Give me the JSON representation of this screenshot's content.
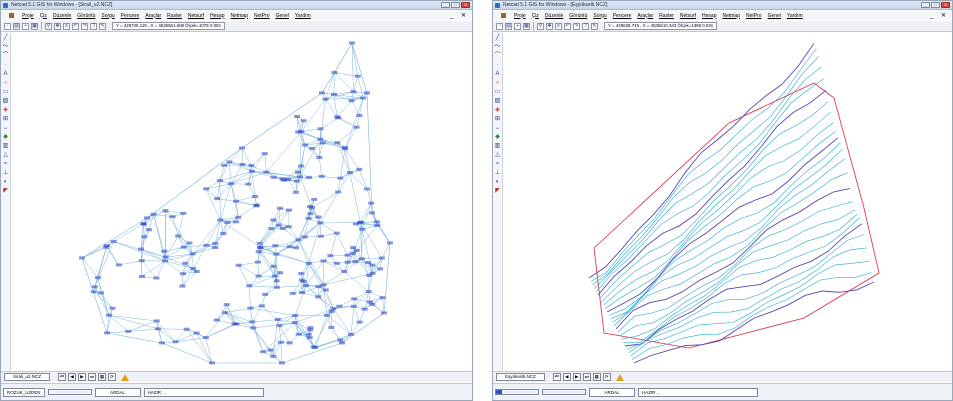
{
  "colors": {
    "tin_line": "#7fb7d9",
    "tin_label": "#2640c8",
    "contour_cyan": "#29a9cf",
    "contour_purple": "#5b43b6",
    "boundary_red": "#e0283a"
  },
  "menu": [
    "Proje",
    "Çiz",
    "Düzenle",
    "Görüntü",
    "Sorgu",
    "Pencere",
    "Araçlar",
    "Raster",
    "Netsurf",
    "Hesap",
    "Netmap",
    "NetPro",
    "Genel",
    "Yardım"
  ],
  "mdi_controls": "_ ✕",
  "windows": {
    "left": {
      "title": "Netcad 5.1 GIS for Windows - [Sirali_u2.NCZ]",
      "coords": "Y = 429725.119 , X = 4535561.608  Ölçek=1075  0.00s",
      "doc_tab": "Sirali_u2.NCZ",
      "status": {
        "layer": "ROZUK_U2DEN",
        "progress": 0,
        "mode": "ARDAL",
        "state": "HAZIR ..."
      }
    },
    "right": {
      "title": "Netcad 5.1 GIS for Windows - [Eşyükselti.NCZ]",
      "coords": "Y = 429628.745 , X = 4535610.343  Ölçek=1398  0.03s",
      "doc_tab": "Eşyükselti.NCZ",
      "status": {
        "layer": "",
        "progress": 0.15,
        "mode": "ARDAL",
        "state": "HAZIR ..."
      }
    }
  },
  "icons": {
    "toolbar": [
      "new-file-icon",
      "open-folder-icon",
      "save-icon",
      "print-icon",
      "layers-icon",
      "zoom-icon",
      "pan-icon",
      "undo-icon",
      "redo-icon",
      "help-icon",
      "pen-icon"
    ],
    "sidebar": [
      "line-icon",
      "polyline-icon",
      "arc-icon",
      "point-icon",
      "text-icon",
      "circle-icon",
      "rectangle-icon",
      "hatch-icon",
      "symbol-icon",
      "measure-icon",
      "dimension-icon",
      "snap-icon",
      "grid-icon",
      "tin-icon",
      "contour-icon",
      "section-icon",
      "fill-icon",
      "layer-icon"
    ]
  }
}
